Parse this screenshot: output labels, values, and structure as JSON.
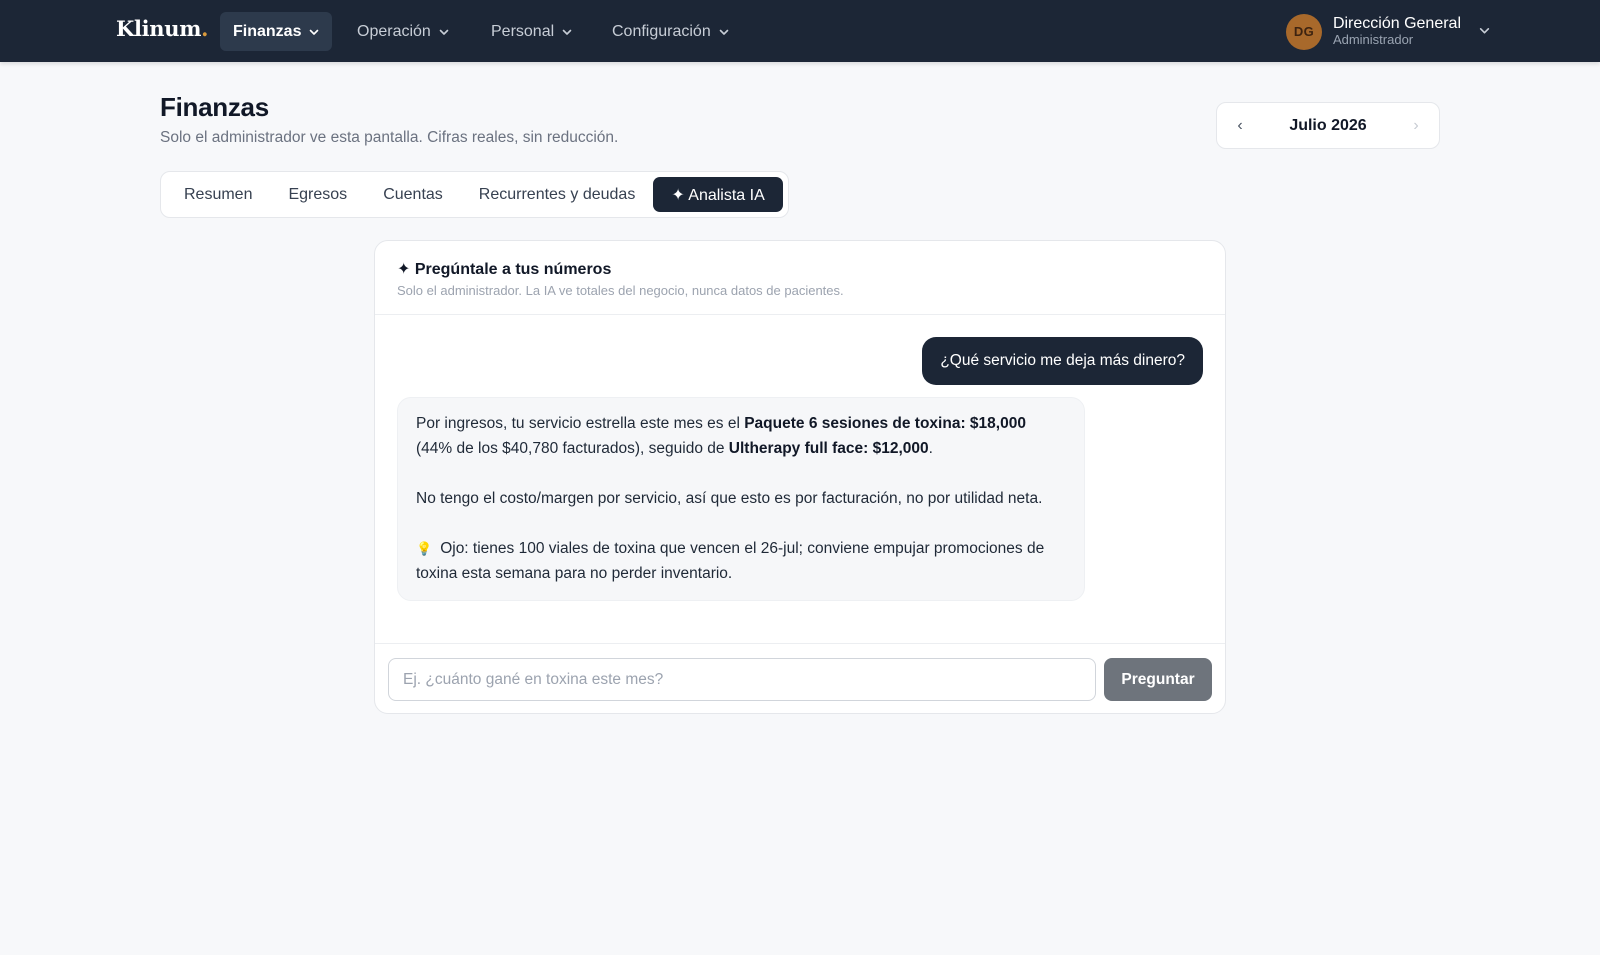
{
  "brand": {
    "name": "Klinum",
    "dot": "."
  },
  "nav": [
    {
      "label": "Finanzas",
      "active": true
    },
    {
      "label": "Operación",
      "active": false
    },
    {
      "label": "Personal",
      "active": false
    },
    {
      "label": "Configuración",
      "active": false
    }
  ],
  "user": {
    "initials": "DG",
    "name": "Dirección General",
    "role": "Administrador"
  },
  "page": {
    "title": "Finanzas",
    "subtitle": "Solo el administrador ve esta pantalla. Cifras reales, sin reducción."
  },
  "month_picker": {
    "label": "Julio 2026",
    "prev": "‹",
    "next": "›"
  },
  "tabs": [
    {
      "label": "Resumen",
      "active": false
    },
    {
      "label": "Egresos",
      "active": false
    },
    {
      "label": "Cuentas",
      "active": false
    },
    {
      "label": "Recurrentes y deudas",
      "active": false
    },
    {
      "label": "✦ Analista IA",
      "active": true
    }
  ],
  "chat": {
    "title": "✦ Pregúntale a tus números",
    "subtitle": "Solo el administrador. La IA ve totales del negocio, nunca datos de pacientes.",
    "user_message": "¿Qué servicio me deja más dinero?",
    "answer": {
      "p1_a": "Por ingresos, tu servicio estrella este mes es el ",
      "p1_b": "Paquete 6 sesiones de toxina: $18,000",
      "p1_c": " (44% de los $40,780 facturados), seguido de ",
      "p1_d": "Ultherapy full face: $12,000",
      "p1_e": ".",
      "p2": "No tengo el costo/margen por servicio, así que esto es por facturación, no por utilidad neta.",
      "p3_icon": "💡",
      "p3": "Ojo: tienes 100 viales de toxina que vencen el 26-jul; conviene empujar promociones de toxina esta semana para no perder inventario."
    },
    "input_placeholder": "Ej. ¿cuánto gané en toxina este mes?",
    "input_value": "",
    "submit_label": "Preguntar"
  },
  "icons": {
    "nav_chevron": "chevron-down-icon",
    "user_chevron": "chevron-down-icon",
    "sparkle": "sparkle-icon",
    "bulb": "lightbulb-icon"
  },
  "colors": {
    "topbar": "#1c2636",
    "accent_dark": "#1c2636",
    "avatar": "#a8692b",
    "brand_dot": "#d99a3c",
    "submit_button": "#6e747c"
  }
}
